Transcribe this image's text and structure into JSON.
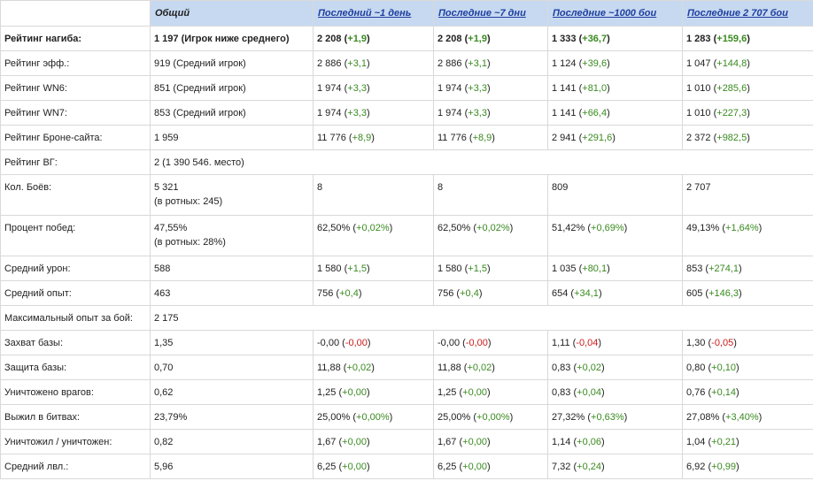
{
  "headers": [
    {
      "label": "",
      "link": false
    },
    {
      "label": "Общий",
      "link": false
    },
    {
      "label": "Последний ~1 день",
      "link": true
    },
    {
      "label": "Последние ~7 дни",
      "link": true
    },
    {
      "label": "Последние ~1000 бои",
      "link": true
    },
    {
      "label": "Последние 2 707 бои",
      "link": true
    }
  ],
  "rows": [
    {
      "name": "rating-nagib",
      "label": "Рейтинг нагиба:",
      "bold": true,
      "height": 28,
      "cells": [
        {
          "main": "1 197 (Игрок ниже среднего)"
        },
        {
          "main": "2 208",
          "delta": "+1,9"
        },
        {
          "main": "2 208",
          "delta": "+1,9"
        },
        {
          "main": "1 333",
          "delta": "+36,7"
        },
        {
          "main": "1 283",
          "delta": "+159,6"
        }
      ]
    },
    {
      "name": "rating-eff",
      "label": "Рейтинг эфф.:",
      "height": 28,
      "cells": [
        {
          "main": "919 (Средний игрок)"
        },
        {
          "main": "2 886",
          "delta": "+3,1"
        },
        {
          "main": "2 886",
          "delta": "+3,1"
        },
        {
          "main": "1 124",
          "delta": "+39,6"
        },
        {
          "main": "1 047",
          "delta": "+144,8"
        }
      ]
    },
    {
      "name": "rating-wn6",
      "label": "Рейтинг WN6:",
      "height": 28,
      "cells": [
        {
          "main": "851 (Средний игрок)"
        },
        {
          "main": "1 974",
          "delta": "+3,3"
        },
        {
          "main": "1 974",
          "delta": "+3,3"
        },
        {
          "main": "1 141",
          "delta": "+81,0"
        },
        {
          "main": "1 010",
          "delta": "+285,6"
        }
      ]
    },
    {
      "name": "rating-wn7",
      "label": "Рейтинг WN7:",
      "height": 28,
      "cells": [
        {
          "main": "853 (Средний игрок)"
        },
        {
          "main": "1 974",
          "delta": "+3,3"
        },
        {
          "main": "1 974",
          "delta": "+3,3"
        },
        {
          "main": "1 141",
          "delta": "+66,4"
        },
        {
          "main": "1 010",
          "delta": "+227,3"
        }
      ]
    },
    {
      "name": "rating-brone",
      "label": "Рейтинг Броне-сайта:",
      "height": 28,
      "cells": [
        {
          "main": "1 959"
        },
        {
          "main": "11 776",
          "delta": "+8,9"
        },
        {
          "main": "11 776",
          "delta": "+8,9"
        },
        {
          "main": "2 941",
          "delta": "+291,6"
        },
        {
          "main": "2 372",
          "delta": "+982,5"
        }
      ]
    },
    {
      "name": "rating-vg",
      "label": "Рейтинг ВГ:",
      "height": 28,
      "span": true,
      "cells": [
        {
          "main": "2 (1 390 546. место)"
        }
      ]
    },
    {
      "name": "battles-count",
      "label": "Кол. Боёв:",
      "height": 46,
      "cells": [
        {
          "main": "5 321",
          "sub": "(в ротных: 245)"
        },
        {
          "main": "8"
        },
        {
          "main": "8"
        },
        {
          "main": "809"
        },
        {
          "main": "2 707"
        }
      ]
    },
    {
      "name": "win-percent",
      "label": "Процент побед:",
      "height": 46,
      "cells": [
        {
          "main": "47,55%",
          "sub": "(в ротных: 28%)"
        },
        {
          "main": "62,50%",
          "delta": "+0,02%"
        },
        {
          "main": "62,50%",
          "delta": "+0,02%"
        },
        {
          "main": "51,42%",
          "delta": "+0,69%"
        },
        {
          "main": "49,13%",
          "delta": "+1,64%"
        }
      ]
    },
    {
      "name": "avg-damage",
      "label": "Средний урон:",
      "height": 28,
      "cells": [
        {
          "main": "588"
        },
        {
          "main": "1 580",
          "delta": "+1,5"
        },
        {
          "main": "1 580",
          "delta": "+1,5"
        },
        {
          "main": "1 035",
          "delta": "+80,1"
        },
        {
          "main": "853",
          "delta": "+274,1"
        }
      ]
    },
    {
      "name": "avg-exp",
      "label": "Средний опыт:",
      "height": 28,
      "cells": [
        {
          "main": "463"
        },
        {
          "main": "756",
          "delta": "+0,4"
        },
        {
          "main": "756",
          "delta": "+0,4"
        },
        {
          "main": "654",
          "delta": "+34,1"
        },
        {
          "main": "605",
          "delta": "+146,3"
        }
      ]
    },
    {
      "name": "max-exp",
      "label": "Максимальный опыт за бой:",
      "height": 28,
      "span": true,
      "cells": [
        {
          "main": "2 175"
        }
      ]
    },
    {
      "name": "base-capture",
      "label": "Захват базы:",
      "height": 28,
      "cells": [
        {
          "main": "1,35"
        },
        {
          "main": "-0,00",
          "delta": "-0,00",
          "neg": true
        },
        {
          "main": "-0,00",
          "delta": "-0,00",
          "neg": true
        },
        {
          "main": "1,11",
          "delta": "-0,04",
          "neg": true
        },
        {
          "main": "1,30",
          "delta": "-0,05",
          "neg": true
        }
      ]
    },
    {
      "name": "base-defense",
      "label": "Защита базы:",
      "height": 28,
      "cells": [
        {
          "main": "0,70"
        },
        {
          "main": "11,88",
          "delta": "+0,02"
        },
        {
          "main": "11,88",
          "delta": "+0,02"
        },
        {
          "main": "0,83",
          "delta": "+0,02"
        },
        {
          "main": "0,80",
          "delta": "+0,10"
        }
      ]
    },
    {
      "name": "enemies-destroyed",
      "label": "Уничтожено врагов:",
      "height": 28,
      "cells": [
        {
          "main": "0,62"
        },
        {
          "main": "1,25",
          "delta": "+0,00"
        },
        {
          "main": "1,25",
          "delta": "+0,00"
        },
        {
          "main": "0,83",
          "delta": "+0,04"
        },
        {
          "main": "0,76",
          "delta": "+0,14"
        }
      ]
    },
    {
      "name": "survived",
      "label": "Выжил в битвах:",
      "height": 28,
      "cells": [
        {
          "main": "23,79%"
        },
        {
          "main": "25,00%",
          "delta": "+0,00%"
        },
        {
          "main": "25,00%",
          "delta": "+0,00%"
        },
        {
          "main": "27,32%",
          "delta": "+0,63%"
        },
        {
          "main": "27,08%",
          "delta": "+3,40%"
        }
      ]
    },
    {
      "name": "kill-death",
      "label": "Уничтожил / уничтожен:",
      "height": 28,
      "cells": [
        {
          "main": "0,82"
        },
        {
          "main": "1,67",
          "delta": "+0,00"
        },
        {
          "main": "1,67",
          "delta": "+0,00"
        },
        {
          "main": "1,14",
          "delta": "+0,06"
        },
        {
          "main": "1,04",
          "delta": "+0,21"
        }
      ]
    },
    {
      "name": "avg-level",
      "label": "Средний лвл.:",
      "height": 28,
      "cells": [
        {
          "main": "5,96"
        },
        {
          "main": "6,25",
          "delta": "+0,00"
        },
        {
          "main": "6,25",
          "delta": "+0,00"
        },
        {
          "main": "7,32",
          "delta": "+0,24"
        },
        {
          "main": "6,92",
          "delta": "+0,99"
        }
      ]
    }
  ]
}
